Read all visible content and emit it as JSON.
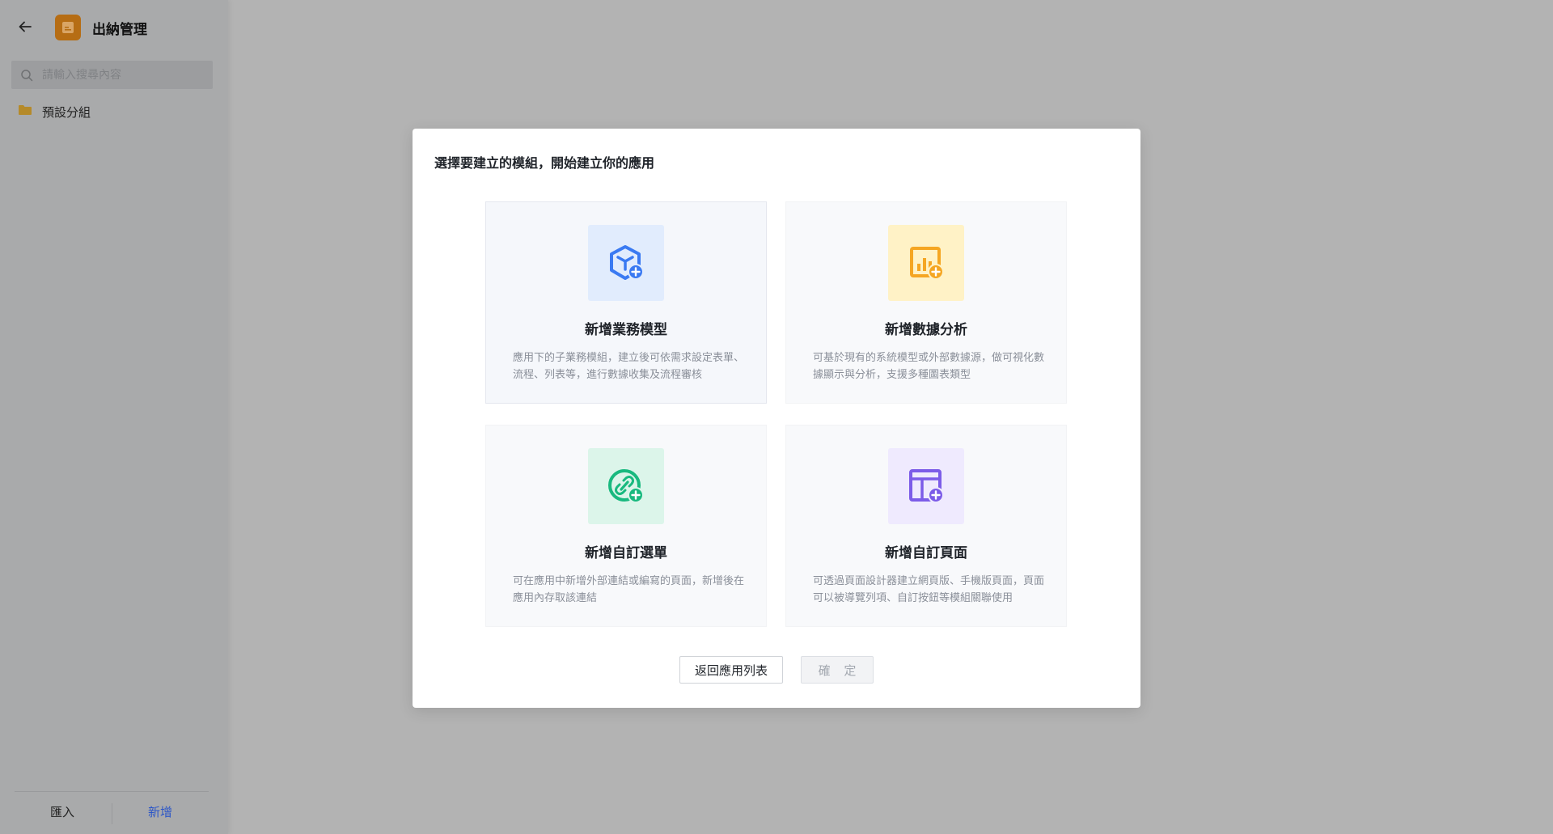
{
  "sidebar": {
    "app_title": "出納管理",
    "search": {
      "placeholder": "請輸入搜尋內容",
      "value": ""
    },
    "groups": [
      {
        "label": "預設分組",
        "icon": "folder-icon"
      }
    ],
    "footer": {
      "import_label": "匯入",
      "new_label": "新增"
    }
  },
  "modal": {
    "title": "選擇要建立的模組，開始建立你的應用",
    "cards": [
      {
        "title": "新增業務模型",
        "description": "應用下的子業務模組，建立後可依需求設定表單、流程、列表等，進行數據收集及流程審核",
        "icon": "business-model-icon",
        "color": "#3a7af2",
        "bg": "#e1ecfd"
      },
      {
        "title": "新增數據分析",
        "description": "可基於現有的系統模型或外部數據源，做可視化數據顯示與分析，支援多種圖表類型",
        "icon": "data-analysis-icon",
        "color": "#f5a623",
        "bg": "#fff2c6"
      },
      {
        "title": "新增自訂選單",
        "description": "可在應用中新增外部連結或編寫的頁面，新增後在應用內存取該連結",
        "icon": "custom-menu-link-icon",
        "color": "#19b97f",
        "bg": "#dcf5ea"
      },
      {
        "title": "新增自訂頁面",
        "description": "可透過頁面設計器建立網頁版、手機版頁面，頁面可以被導覽列項、自訂按鈕等模組關聯使用",
        "icon": "custom-page-icon",
        "color": "#7c5ce8",
        "bg": "#efeafe"
      }
    ],
    "back_button": "返回應用列表",
    "confirm_button": "確 定"
  },
  "colors": {
    "accent": "#2c56c7",
    "overlay": "#b3b3b3",
    "app_icon": "#b66d14"
  }
}
